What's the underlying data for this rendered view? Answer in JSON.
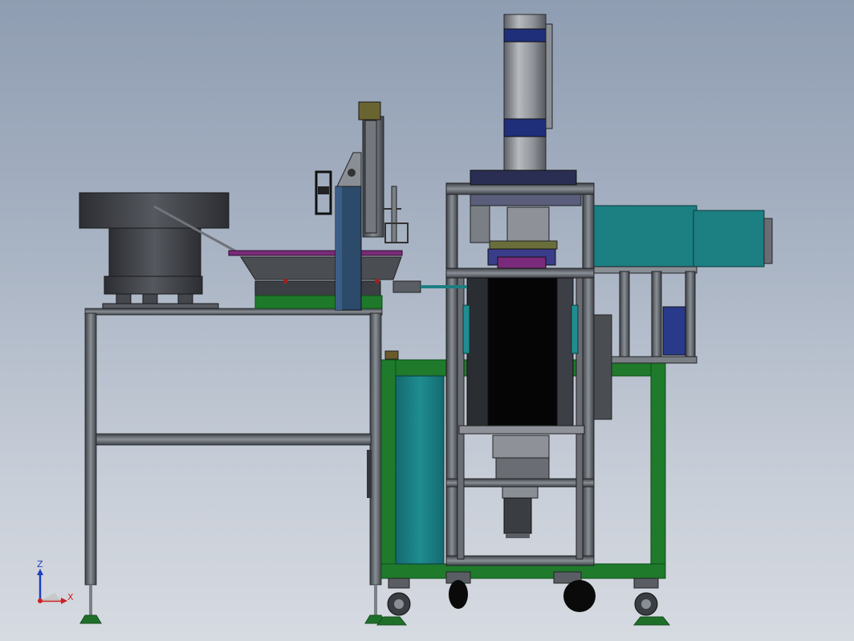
{
  "viewport": {
    "background_top": "#8f9db2",
    "background_bottom": "#d6dae1"
  },
  "axis_triad": {
    "z_label": "Z",
    "x_label": "X",
    "z_color": "#1f3fbf",
    "x_color": "#cc2222",
    "origin_color": "#d02020"
  },
  "model": {
    "frame_color": "#5a5f66",
    "base_panel_color": "#1f7a2c",
    "panel_fill_color": "#1c7f82",
    "cylinder_color": "#8c9096",
    "bowl_color": "#3e4046",
    "slot_color": "#050505",
    "collar_color": "#1f2f7a"
  }
}
